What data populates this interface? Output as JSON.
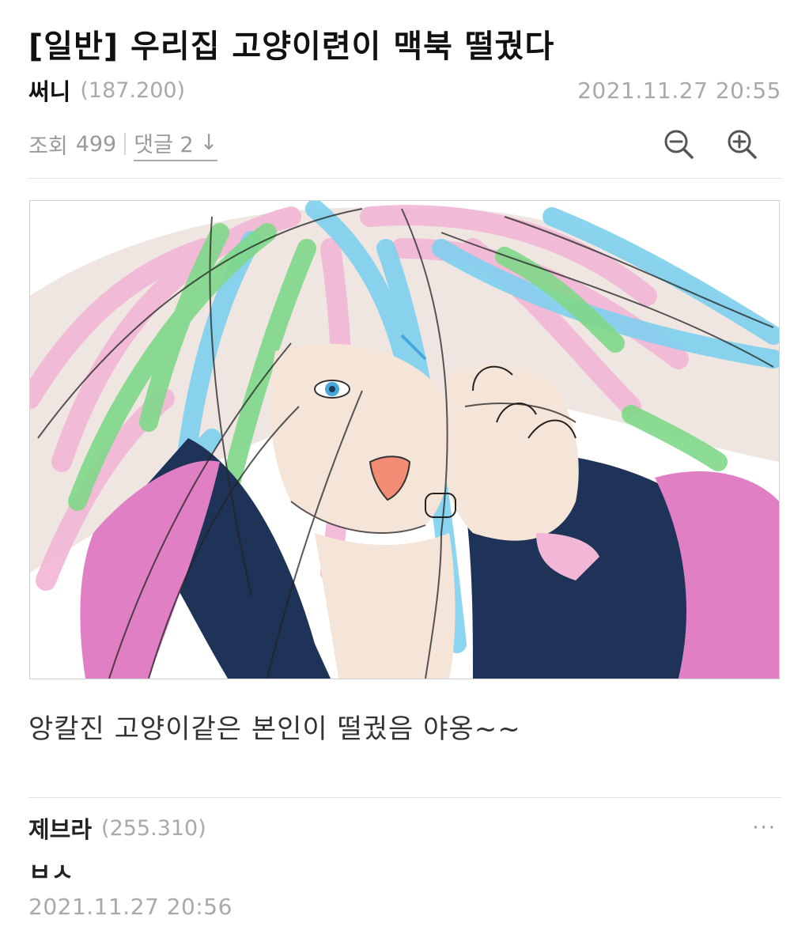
{
  "post": {
    "title": "[일반]  우리집  고양이련이  맥북  떨궜다",
    "author": "써니",
    "author_id": "(187.200)",
    "date": "2021.11.27  20:55",
    "views_label": "조회",
    "views_count": "499",
    "comments_label": "댓글 2",
    "comments_arrow": "↓",
    "body": "앙칼진 고양이같은 본인이 떨궜음 야옹~~"
  },
  "toolbar": {
    "zoom_out_icon": "zoom-out-icon",
    "zoom_in_icon": "zoom-in-icon"
  },
  "comment": {
    "author": "제브라",
    "author_id": "(255.310)",
    "more": "···",
    "text": "ㅂㅅ",
    "date": "2021.11.27 20:56"
  },
  "colors": {
    "hair_pink": "#f2b6d6",
    "hair_blue": "#7fd0ef",
    "hair_green": "#7fd88a",
    "hair_white": "#efe6e1",
    "jacket_navy": "#1f3358",
    "sleeve_pink": "#e07fc3",
    "skin": "#f5e4d8",
    "eye_blue": "#46a7dc",
    "tongue": "#f28c75"
  }
}
